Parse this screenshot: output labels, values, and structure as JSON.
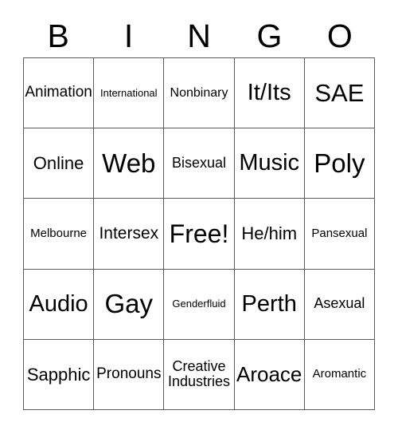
{
  "card": {
    "title": "BINGO",
    "header": {
      "letters": [
        "B",
        "I",
        "N",
        "G",
        "O"
      ]
    },
    "grid": {
      "columns": 5,
      "rows": 5,
      "border_color": "#5a5a5a",
      "background_color": "#ffffff",
      "text_color": "#000000"
    },
    "cells": [
      {
        "row": 1,
        "col": 1,
        "label": "Animation",
        "size": "fs-mdl",
        "free": false
      },
      {
        "row": 1,
        "col": 2,
        "label": "International",
        "size": "fs-xs",
        "free": false
      },
      {
        "row": 1,
        "col": 3,
        "label": "Nonbinary",
        "size": "fs-smd",
        "free": false
      },
      {
        "row": 1,
        "col": 4,
        "label": "It/Its",
        "size": "fs-xxl",
        "free": false
      },
      {
        "row": 1,
        "col": 5,
        "label": "SAE",
        "size": "fs-h1",
        "free": false
      },
      {
        "row": 2,
        "col": 1,
        "label": "Online",
        "size": "fs-lgx",
        "free": false
      },
      {
        "row": 2,
        "col": 2,
        "label": "Web",
        "size": "fs-h2",
        "free": false
      },
      {
        "row": 2,
        "col": 3,
        "label": "Bisexual",
        "size": "fs-md",
        "free": false
      },
      {
        "row": 2,
        "col": 4,
        "label": "Music",
        "size": "fs-xxl",
        "free": false
      },
      {
        "row": 2,
        "col": 5,
        "label": "Poly",
        "size": "fs-h2",
        "free": false
      },
      {
        "row": 3,
        "col": 1,
        "label": "Melbourne",
        "size": "fs-sm",
        "free": false
      },
      {
        "row": 3,
        "col": 2,
        "label": "Intersex",
        "size": "fs-lg",
        "free": false
      },
      {
        "row": 3,
        "col": 3,
        "label": "Free!",
        "size": "fs-free",
        "free": true
      },
      {
        "row": 3,
        "col": 4,
        "label": "He/him",
        "size": "fs-lgx",
        "free": false
      },
      {
        "row": 3,
        "col": 5,
        "label": "Pansexual",
        "size": "fs-sm",
        "free": false
      },
      {
        "row": 4,
        "col": 1,
        "label": "Audio",
        "size": "fs-xxl",
        "free": false
      },
      {
        "row": 4,
        "col": 2,
        "label": "Gay",
        "size": "fs-h2",
        "free": false
      },
      {
        "row": 4,
        "col": 3,
        "label": "Genderfluid",
        "size": "fs-xs",
        "free": false
      },
      {
        "row": 4,
        "col": 4,
        "label": "Perth",
        "size": "fs-xxl",
        "free": false
      },
      {
        "row": 4,
        "col": 5,
        "label": "Asexual",
        "size": "fs-md",
        "free": false
      },
      {
        "row": 5,
        "col": 1,
        "label": "Sapphic",
        "size": "fs-lgx",
        "free": false
      },
      {
        "row": 5,
        "col": 2,
        "label": "Pronouns",
        "size": "fs-mdl",
        "free": false
      },
      {
        "row": 5,
        "col": 3,
        "label": "Creative\nIndustries",
        "size": "fs-md",
        "free": false
      },
      {
        "row": 5,
        "col": 4,
        "label": "Aroace",
        "size": "fs-xl",
        "free": false
      },
      {
        "row": 5,
        "col": 5,
        "label": "Aromantic",
        "size": "fs-sm",
        "free": false
      }
    ]
  }
}
